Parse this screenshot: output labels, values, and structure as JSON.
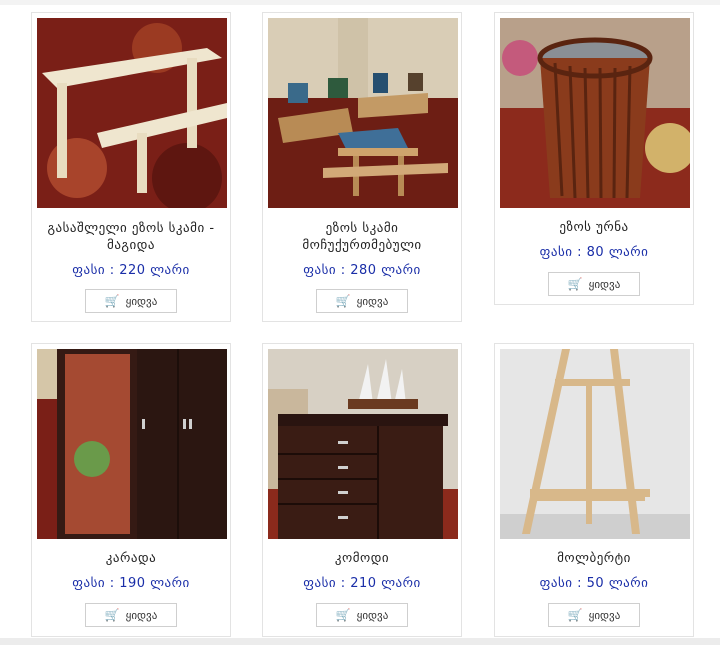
{
  "products": [
    {
      "title": "გასაშლელი ეზოს სკამი - მაგიდა",
      "price": "ფასი : 220 ლარი",
      "buy": "ყიდვა",
      "cart_icon": "cart-icon"
    },
    {
      "title": "ეზოს სკამი მოჩუქურთმებული",
      "price": "ფასი : 280 ლარი",
      "buy": "ყიდვა",
      "cart_icon": "cart-icon"
    },
    {
      "title": "ეზოს ურნა",
      "price": "ფასი : 80 ლარი",
      "buy": "ყიდვა",
      "cart_icon": "cart-icon"
    },
    {
      "title": "კარადა",
      "price": "ფასი : 190 ლარი",
      "buy": "ყიდვა",
      "cart_icon": "cart-icon"
    },
    {
      "title": "კომოდი",
      "price": "ფასი : 210 ლარი",
      "buy": "ყიდვა",
      "cart_icon": "cart-icon"
    },
    {
      "title": "მოლბერტი",
      "price": "ფასი : 50 ლარი",
      "buy": "ყიდვა",
      "cart_icon": "cart-icon"
    }
  ],
  "colors": {
    "price": "#1a2ea8",
    "card_border": "#e3e3e3"
  }
}
